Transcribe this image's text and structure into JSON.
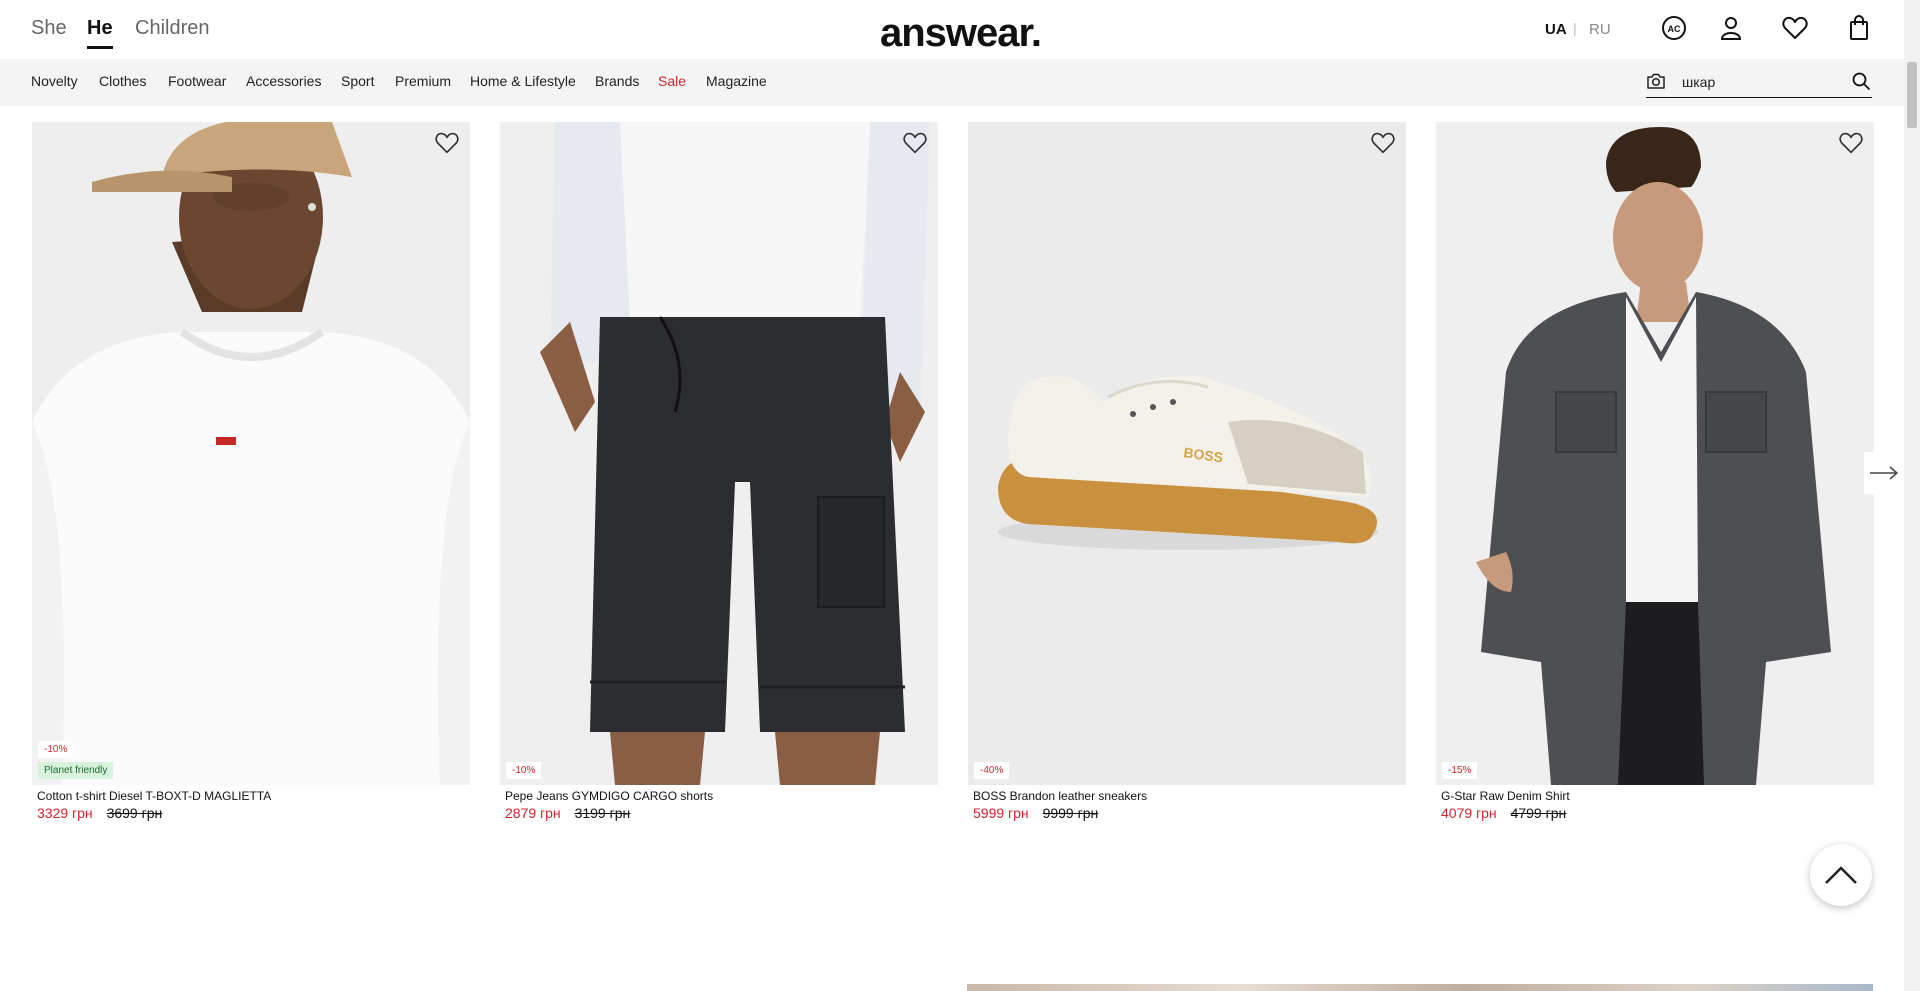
{
  "header": {
    "genders": [
      {
        "label": "She",
        "active": false
      },
      {
        "label": "He",
        "active": true
      },
      {
        "label": "Children",
        "active": false
      }
    ],
    "logo": "answear.",
    "languages": [
      {
        "label": "UA",
        "active": true
      },
      {
        "label": "RU",
        "active": false
      }
    ],
    "lang_separator": "|",
    "icons": [
      "ac-club-icon",
      "user-icon",
      "heart-icon",
      "shopping-bag-icon"
    ],
    "club_icon_label": "AC"
  },
  "nav": {
    "items": [
      "Novelty",
      "Clothes",
      "Footwear",
      "Accessories",
      "Sport",
      "Premium",
      "Home & Lifestyle",
      "Brands",
      "Sale",
      "Magazine"
    ],
    "search_value": "шкар"
  },
  "products": [
    {
      "name": "Cotton t-shirt Diesel T-BOXT-D MAGLIETTA",
      "price": "3329 грн",
      "old_price": "3699 грн",
      "discount": "-10%",
      "eco": "Planet friendly"
    },
    {
      "name": "Pepe Jeans GYMDIGO CARGO shorts",
      "price": "2879 грн",
      "old_price": "3199 грн",
      "discount": "-10%"
    },
    {
      "name": "BOSS Brandon leather sneakers",
      "price": "5999 грн",
      "old_price": "9999 грн",
      "discount": "-40%",
      "shoe_brand": "BOSS"
    },
    {
      "name": "G-Star Raw Denim Shirt",
      "price": "4079 грн",
      "old_price": "4799 грн",
      "discount": "-15%"
    }
  ],
  "colors": {
    "sale_red": "#d3232a",
    "nav_bg": "#f4f4f4",
    "eco_badge_bg": "#d8f3dc"
  }
}
